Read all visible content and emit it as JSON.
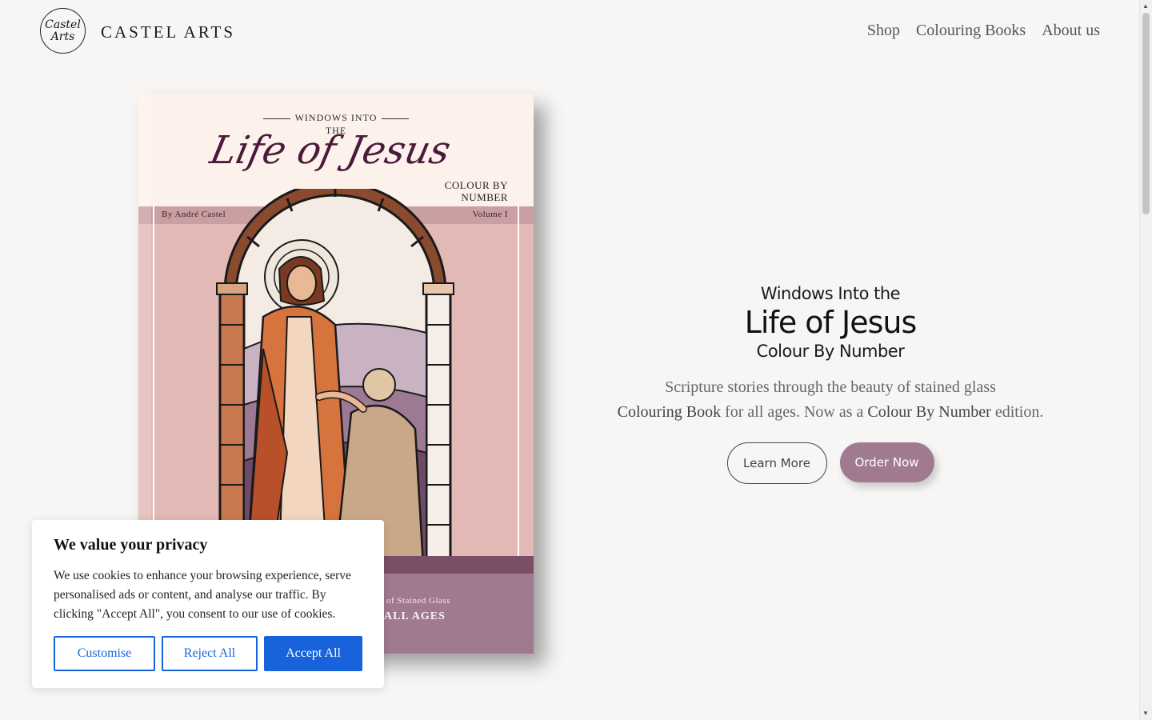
{
  "header": {
    "logo_line1": "Castel",
    "logo_line2": "Arts",
    "brand": "CASTEL ARTS",
    "nav": [
      "Shop",
      "Colouring Books",
      "About us"
    ]
  },
  "cover": {
    "small_title": "WINDOWS INTO",
    "the": "THE",
    "script_title": "Life of Jesus",
    "cbn_line1": "COLOUR BY",
    "cbn_line2": "NUMBER",
    "author": "By André Castel",
    "volume": "Volume I",
    "stained": "of Stained Glass",
    "all_ages": "ALL AGES"
  },
  "hero": {
    "line1": "Windows Into the",
    "line2": "Life of Jesus",
    "line3": "Colour By Number",
    "desc_line1": "Scripture stories through the beauty of stained glass",
    "desc_bold1": "Colouring Book",
    "desc_mid": " for all ages. Now as a ",
    "desc_bold2": "Colour By Number",
    "desc_end": " edition.",
    "learn_more": "Learn More",
    "order_now": "Order Now"
  },
  "cookie": {
    "title": "We value your privacy",
    "text": "We use cookies to enhance your browsing experience, serve personalised ads or content, and analyse our traffic. By clicking \"Accept All\", you consent to our use of cookies.",
    "customise": "Customise",
    "reject": "Reject All",
    "accept": "Accept All"
  },
  "colors": {
    "accent": "#a07a91",
    "cookie_blue": "#1863dc",
    "background": "#f7f6f4"
  }
}
